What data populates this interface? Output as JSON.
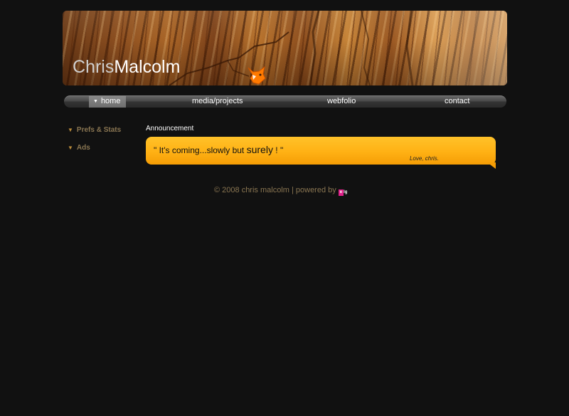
{
  "header": {
    "logo_first": "Chris",
    "logo_last": "Malcolm",
    "logo_icon": "fox-icon"
  },
  "nav": {
    "items": [
      {
        "label": "home",
        "active": true
      },
      {
        "label": "media/projects",
        "active": false
      },
      {
        "label": "webfolio",
        "active": false
      },
      {
        "label": "contact",
        "active": false
      }
    ]
  },
  "sidebar": {
    "items": [
      {
        "label": "Prefs & Stats"
      },
      {
        "label": "Ads"
      }
    ]
  },
  "announcement": {
    "heading": "Announcement",
    "quote_part1": "\" It's coming...slowly but ",
    "quote_emph": "surely",
    "quote_part2": " ! \"",
    "signature": "Love, chris."
  },
  "footer": {
    "text": "© 2008 chris malcolm | powered by",
    "badge": "elgg"
  },
  "colors": {
    "background": "#111111",
    "accent_orange": "#ffb114",
    "sidebar_text": "#8a7652",
    "logo_orange": "#ff7a00"
  }
}
